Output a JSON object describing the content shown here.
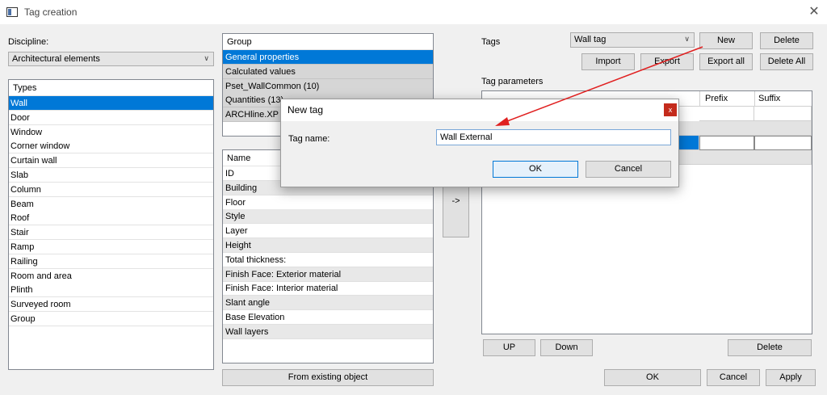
{
  "window": {
    "title": "Tag creation"
  },
  "discipline": {
    "label": "Discipline:",
    "selected": "Architectural elements"
  },
  "types": {
    "header": "Types",
    "items": [
      "Wall",
      "Door",
      "Window",
      "Corner window",
      "Curtain wall",
      "Slab",
      "Column",
      "Beam",
      "Roof",
      "Stair",
      "Ramp",
      "Railing",
      "Room and area",
      "Plinth",
      "Surveyed room",
      "Group"
    ]
  },
  "group": {
    "header": "Group",
    "items": [
      "General properties",
      "Calculated values",
      "Pset_WallCommon (10)",
      "Quantities (13)",
      "ARCHline.XP Co"
    ]
  },
  "names": {
    "header": "Name",
    "items": [
      "ID",
      "Building",
      "Floor",
      "Style",
      "Layer",
      "Height",
      "Total thickness:",
      "Finish Face: Exterior material",
      "Finish Face: Interior material",
      "Slant angle",
      "Base Elevation",
      "Wall layers"
    ]
  },
  "arrow_button": "->",
  "from_existing_button": "From existing object",
  "tags": {
    "label": "Tags",
    "selected": "Wall tag",
    "new_button": "New",
    "delete_button": "Delete",
    "import_button": "Import",
    "export_button": "Export",
    "export_all_button": "Export all",
    "delete_all_button": "Delete All"
  },
  "tag_parameters": {
    "label": "Tag parameters",
    "columns": [
      "Prefix",
      "Suffix"
    ],
    "up_button": "UP",
    "down_button": "Down",
    "delete_button": "Delete"
  },
  "footer": {
    "ok_button": "OK",
    "cancel_button": "Cancel",
    "apply_button": "Apply"
  },
  "new_tag_dialog": {
    "title": "New tag",
    "close_glyph": "x",
    "name_label": "Tag name:",
    "name_value": "Wall External",
    "ok_button": "OK",
    "cancel_button": "Cancel"
  },
  "colors": {
    "selection": "#0078d7",
    "annotation_arrow": "#e02020",
    "close_red": "#c42b1c"
  }
}
